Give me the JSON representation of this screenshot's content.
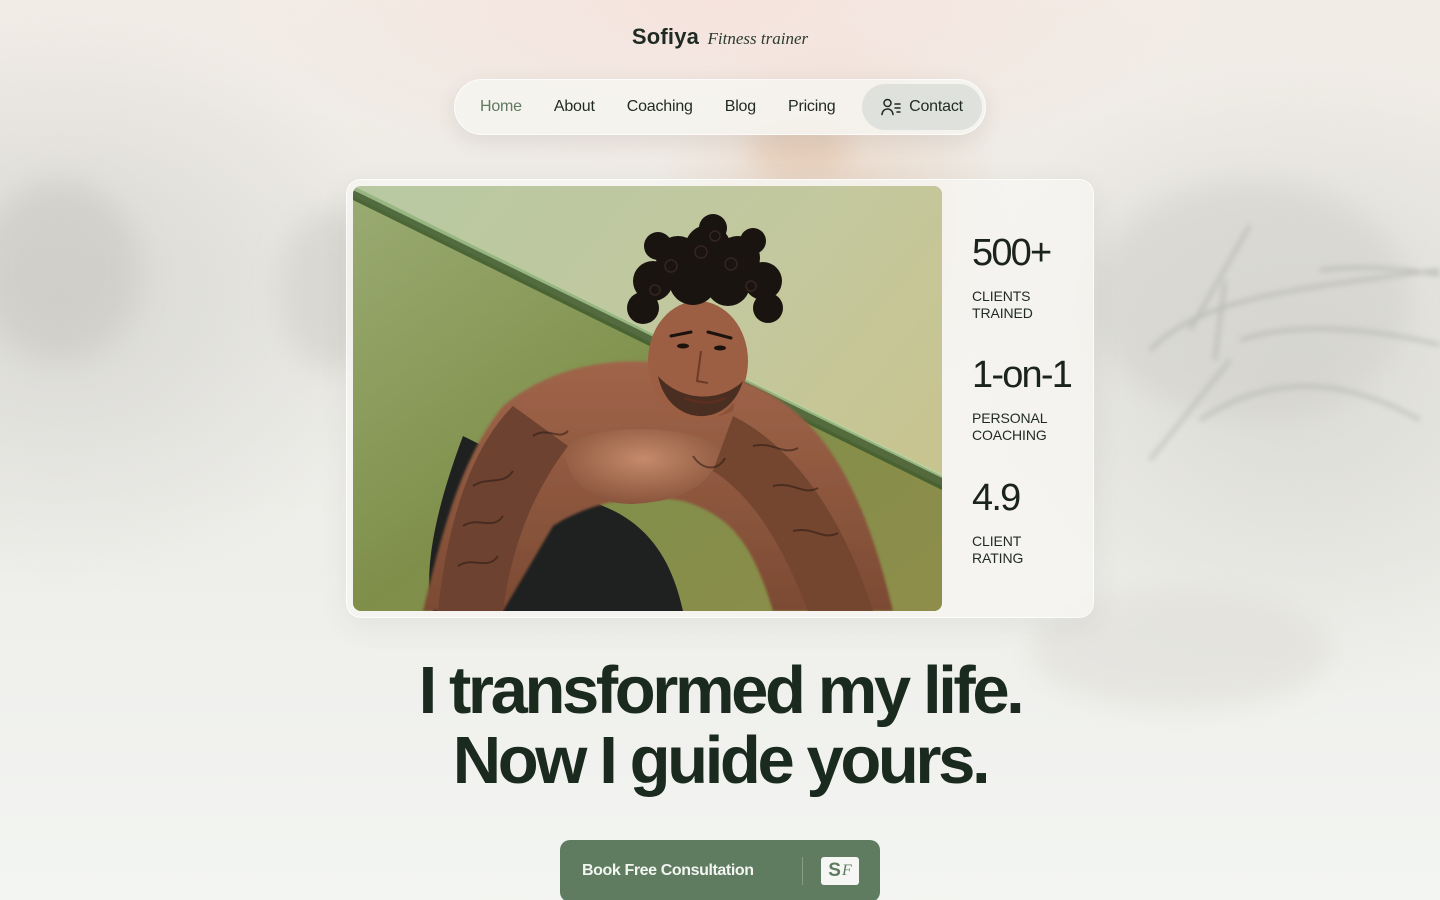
{
  "brand": {
    "name": "Sofiya",
    "tagline": "Fitness trainer"
  },
  "nav": {
    "items": [
      {
        "label": "Home",
        "active": true
      },
      {
        "label": "About",
        "active": false
      },
      {
        "label": "Coaching",
        "active": false
      },
      {
        "label": "Blog",
        "active": false
      },
      {
        "label": "Pricing",
        "active": false
      }
    ],
    "contact": {
      "label": "Contact",
      "icon": "user-list-icon"
    }
  },
  "hero": {
    "photo_alt": "photo-of-tattooed-man-doing-push-up",
    "stats": [
      {
        "value": "500+",
        "label": "Clients trained"
      },
      {
        "value": "1-on-1",
        "label": "Personal coaching"
      },
      {
        "value": "4.9",
        "label": "Client rating"
      }
    ]
  },
  "headline": {
    "line1": "I transformed my life.",
    "line2": "Now I guide yours."
  },
  "cta": {
    "label": "Book Free Consultation",
    "logo_s": "S",
    "logo_f": "F"
  },
  "colors": {
    "accent": "#5f7b60",
    "active_nav": "#5e7a5f",
    "text": "#1b2a1e",
    "contact_bg": "#dfe2dc"
  }
}
